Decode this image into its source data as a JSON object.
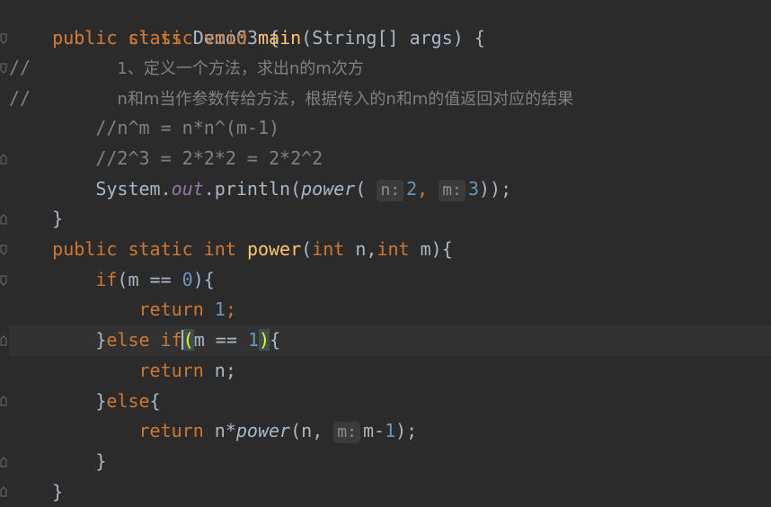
{
  "code": {
    "l1": {
      "kw1": "public",
      "kw2": "class",
      "name": "Demo03",
      "brace": "{"
    },
    "l2": {
      "kw1": "public",
      "kw2": "static",
      "kw3": "void",
      "fn": "main",
      "rest": "(String[] args) {"
    },
    "l3": {
      "slashes": "//",
      "text": "1、定义一个方法，求出n的m次方"
    },
    "l4": {
      "slashes": "//",
      "text": "n和m当作参数传给方法，根据传入的n和m的值返回对应的结果"
    },
    "l5": {
      "text": "//n^m = n*n^(m-1)"
    },
    "l6": {
      "text": "//2^3 = 2*2*2 = 2*2^2"
    },
    "l7": {
      "cls": "System.",
      "field": "out",
      "call": ".println(",
      "fn": "power",
      "open": "(",
      "hint_n": "n:",
      "arg1": "2",
      "comma": ",",
      "hint_m": "m:",
      "arg2": "3",
      "close": "));"
    },
    "l8": {
      "brace": "}"
    },
    "l9": {
      "kw1": "public",
      "kw2": "static",
      "kw3": "int",
      "fn": "power",
      "open": "(",
      "t1": "int",
      "p1": "n,",
      "t2": "int",
      "p2": "m){"
    },
    "l10": {
      "kw": "if",
      "pre": "(m == ",
      "num": "0",
      "post": "){"
    },
    "l11": {
      "kw": "return",
      "num": "1",
      "semi": ";"
    },
    "l12": {
      "close": "}",
      "kw": "else if",
      "open": "(",
      "mid": "m == ",
      "num": "1",
      "paren": ")",
      "brace": "{"
    },
    "l13": {
      "kw": "return",
      "rest": "n;"
    },
    "l14": {
      "close": "}",
      "kw": "else",
      "brace": "{"
    },
    "l15": {
      "kw": "return",
      "pre": "n*",
      "fn": "power",
      "open": "(n,",
      "hint_m": "m:",
      "mid": "m-",
      "num": "1",
      "close": ");"
    },
    "l16": {
      "brace": "}"
    },
    "l17": {
      "brace": "}"
    }
  },
  "colors": {
    "background": "#2b2b2b",
    "keyword": "#cc7832",
    "function": "#ffc66d",
    "number": "#6897bb",
    "comment": "#808080",
    "static_field": "#9876aa",
    "text": "#a9b7c6"
  }
}
